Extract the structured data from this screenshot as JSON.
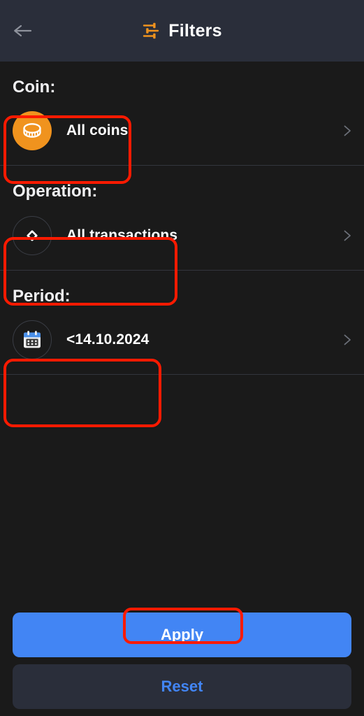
{
  "header": {
    "title": "Filters",
    "back_icon": "arrow-left-icon",
    "filters_icon": "sliders-icon",
    "accent": "#f0931e",
    "background": "#2a2e3a"
  },
  "sections": [
    {
      "label": "Coin:",
      "name": "coin",
      "icon": "coin-icon",
      "icon_bg": "#f0931e",
      "value": "All coins",
      "chevron": "chevron-right-icon",
      "highlighted": true
    },
    {
      "label": "Operation:",
      "name": "operation",
      "icon": "diamond-icon",
      "icon_bg": "transparent",
      "value": "All transactions",
      "chevron": "chevron-right-icon",
      "highlighted": true
    },
    {
      "label": "Period:",
      "name": "period",
      "icon": "calendar-icon",
      "icon_bg": "transparent",
      "value": "<14.10.2024",
      "chevron": "chevron-right-icon",
      "highlighted": true
    }
  ],
  "footer": {
    "apply_label": "Apply",
    "apply_bg": "#4285f4",
    "apply_color": "#ffffff",
    "reset_label": "Reset",
    "reset_bg": "#2a2e3a",
    "reset_color": "#4285f4"
  },
  "annotations": {
    "color": "#ff1a00",
    "targets": [
      "coin-row",
      "operation-row",
      "period-row",
      "apply-button"
    ]
  },
  "theme": {
    "page_background": "#1a1a1a",
    "divider": "#33363d",
    "text_primary": "#ffffff",
    "text_muted": "#6c7079"
  }
}
